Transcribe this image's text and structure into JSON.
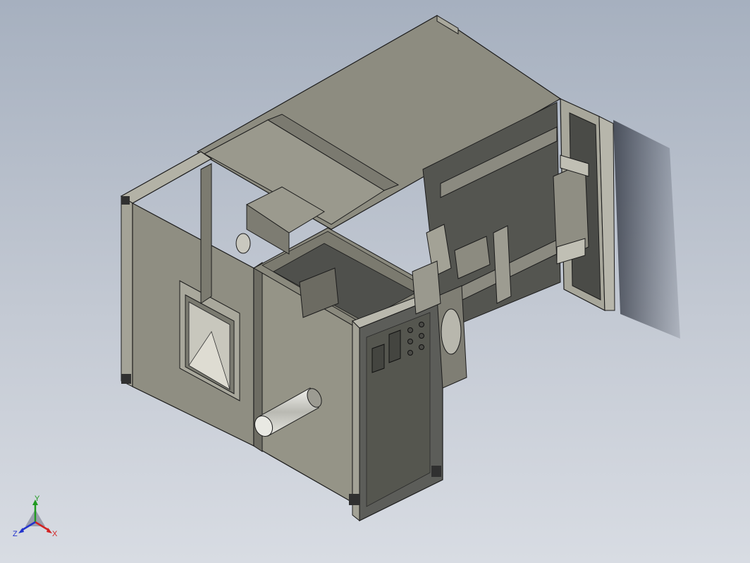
{
  "viewport": {
    "background_top": "#a6b0bf",
    "background_bottom": "#d8dce3"
  },
  "model": {
    "body_color": "#8e8d7f",
    "panel_dark": "#5b5c58",
    "frame_color": "#a9a89c",
    "edge_color": "#1c1c1c"
  },
  "triad": {
    "x_label": "X",
    "y_label": "Y",
    "z_label": "Z",
    "x_color": "#d22222",
    "y_color": "#1f9a1f",
    "z_color": "#2233cc"
  }
}
